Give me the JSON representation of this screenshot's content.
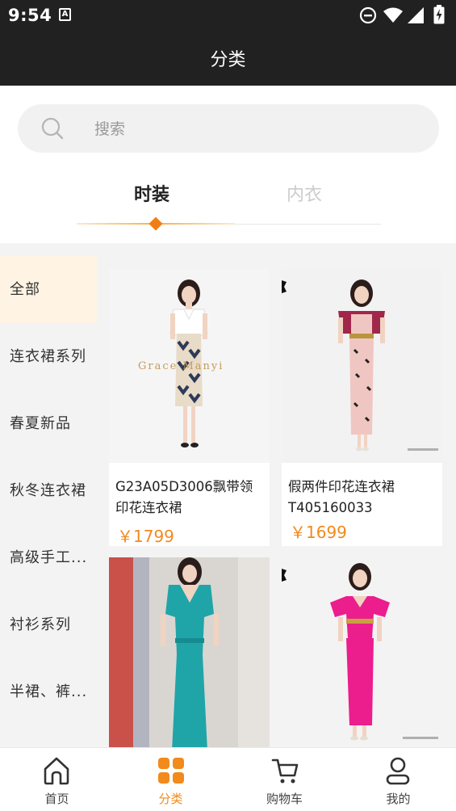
{
  "status_bar": {
    "time": "9:54",
    "notification_icon": "A"
  },
  "header": {
    "title": "分类"
  },
  "search": {
    "placeholder": "搜索"
  },
  "tabs": [
    {
      "label": "时装",
      "active": true
    },
    {
      "label": "内衣",
      "active": false
    }
  ],
  "sidebar": {
    "items": [
      {
        "label": "全部",
        "active": true
      },
      {
        "label": "连衣裙系列"
      },
      {
        "label": "春夏新品"
      },
      {
        "label": "秋冬连衣裙"
      },
      {
        "label": "高级手工..."
      },
      {
        "label": "衬衫系列"
      },
      {
        "label": "半裙、裤..."
      }
    ]
  },
  "products": [
    {
      "title": "G23A05D3006飘带领印花连衣裙",
      "price": "￥1799",
      "watermark": "Grace Manyi"
    },
    {
      "title": "假两件印花连衣裙T405160033",
      "price": "￥1699"
    },
    {
      "title": "",
      "price": ""
    },
    {
      "title": "",
      "price": ""
    }
  ],
  "bottom_nav": [
    {
      "label": "首页",
      "icon": "home-icon"
    },
    {
      "label": "分类",
      "icon": "category-icon",
      "active": true
    },
    {
      "label": "购物车",
      "icon": "cart-icon"
    },
    {
      "label": "我的",
      "icon": "profile-icon"
    }
  ],
  "colors": {
    "accent": "#f28a1c",
    "header_bg": "#212121",
    "sidebar_active_bg": "#fff4e4"
  }
}
